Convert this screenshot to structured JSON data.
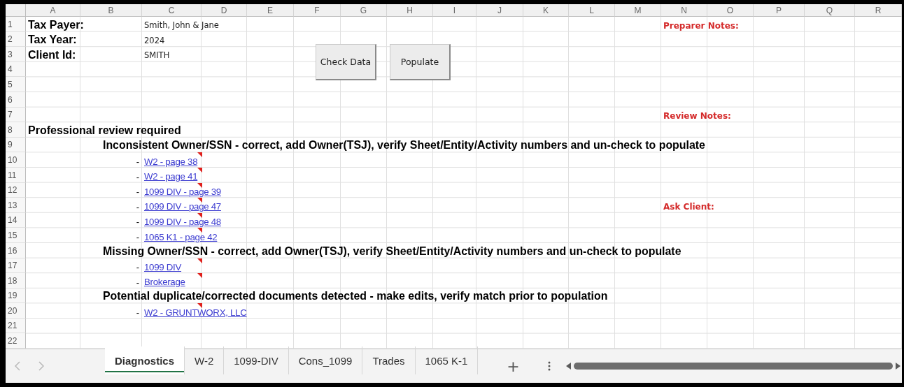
{
  "columns": [
    "A",
    "B",
    "C",
    "D",
    "E",
    "F",
    "G",
    "H",
    "I",
    "J",
    "K",
    "L",
    "M",
    "N",
    "O",
    "P",
    "Q",
    "R"
  ],
  "rows": [
    {
      "number": "1",
      "cells": [
        {
          "kind": "label",
          "text": "Tax Payer:"
        },
        null,
        {
          "kind": "value",
          "text": "Smith, John & Jane"
        },
        null,
        null,
        null,
        null,
        null,
        null,
        null,
        null,
        null,
        null,
        {
          "kind": "note",
          "text": "Preparer Notes:"
        }
      ]
    },
    {
      "number": "2",
      "cells": [
        {
          "kind": "label",
          "text": "Tax Year:"
        },
        null,
        {
          "kind": "value",
          "text": "2024"
        }
      ]
    },
    {
      "number": "3",
      "cells": [
        {
          "kind": "label",
          "text": "Client Id:"
        },
        null,
        {
          "kind": "value",
          "text": "SMITH"
        }
      ]
    },
    {
      "number": "4",
      "cells": []
    },
    {
      "number": "5",
      "cells": []
    },
    {
      "number": "6",
      "cells": []
    },
    {
      "number": "7",
      "cells": [
        null,
        null,
        null,
        null,
        null,
        null,
        null,
        null,
        null,
        null,
        null,
        null,
        null,
        {
          "kind": "note",
          "text": "Review Notes:"
        }
      ]
    },
    {
      "number": "8",
      "cells": [
        {
          "kind": "title",
          "text": "Professional review required"
        }
      ]
    },
    {
      "number": "9",
      "cells": [
        null,
        {
          "kind": "heading",
          "text": "Inconsistent Owner/SSN - correct, add Owner(TSJ), verify Sheet/Entity/Activity numbers and un-check to populate"
        }
      ]
    },
    {
      "number": "10",
      "cells": [
        null,
        {
          "kind": "dash",
          "text": "-"
        },
        {
          "kind": "link",
          "text": "W2 - page 38",
          "comment": true
        }
      ]
    },
    {
      "number": "11",
      "cells": [
        null,
        {
          "kind": "dash",
          "text": "-"
        },
        {
          "kind": "link",
          "text": "W2 - page 41",
          "comment": true
        }
      ]
    },
    {
      "number": "12",
      "cells": [
        null,
        {
          "kind": "dash",
          "text": "-"
        },
        {
          "kind": "link",
          "text": "1099 DIV - page 39",
          "comment": true
        }
      ]
    },
    {
      "number": "13",
      "cells": [
        null,
        {
          "kind": "dash",
          "text": "-"
        },
        {
          "kind": "link",
          "text": "1099 DIV - page 47",
          "comment": true
        },
        null,
        null,
        null,
        null,
        null,
        null,
        null,
        null,
        null,
        null,
        {
          "kind": "note",
          "text": "Ask Client:"
        }
      ]
    },
    {
      "number": "14",
      "cells": [
        null,
        {
          "kind": "dash",
          "text": "-"
        },
        {
          "kind": "link",
          "text": "1099 DIV - page 48",
          "comment": true
        }
      ]
    },
    {
      "number": "15",
      "cells": [
        null,
        {
          "kind": "dash",
          "text": "-"
        },
        {
          "kind": "link",
          "text": "1065 K1 - page 42",
          "comment": true
        }
      ]
    },
    {
      "number": "16",
      "cells": [
        null,
        {
          "kind": "heading",
          "text": "Missing Owner/SSN - correct, add Owner(TSJ), verify Sheet/Entity/Activity numbers and un-check to populate"
        }
      ]
    },
    {
      "number": "17",
      "cells": [
        null,
        {
          "kind": "dash",
          "text": "-"
        },
        {
          "kind": "link",
          "text": "1099 DIV",
          "comment": true
        }
      ]
    },
    {
      "number": "18",
      "cells": [
        null,
        {
          "kind": "dash",
          "text": "-"
        },
        {
          "kind": "link",
          "text": "Brokerage",
          "comment": true
        }
      ]
    },
    {
      "number": "19",
      "cells": [
        null,
        {
          "kind": "heading",
          "text": "Potential duplicate/corrected documents detected - make edits, verify match prior to population"
        }
      ]
    },
    {
      "number": "20",
      "cells": [
        null,
        {
          "kind": "dash",
          "text": "-"
        },
        {
          "kind": "link",
          "text": "W2 - GRUNTWORX, LLC",
          "comment": true
        }
      ]
    },
    {
      "number": "21",
      "cells": []
    },
    {
      "number": "22",
      "cells": []
    }
  ],
  "buttons": [
    {
      "label": "Check Data"
    },
    {
      "label": "Populate"
    }
  ],
  "sheet_tabs": [
    {
      "label": "Diagnostics",
      "selected": true
    },
    {
      "label": "W-2",
      "selected": false
    },
    {
      "label": "1099-DIV",
      "selected": false
    },
    {
      "label": "Cons_1099",
      "selected": false
    },
    {
      "label": "Trades",
      "selected": false
    },
    {
      "label": "1065 K-1",
      "selected": false
    }
  ],
  "add_sheet": "+"
}
